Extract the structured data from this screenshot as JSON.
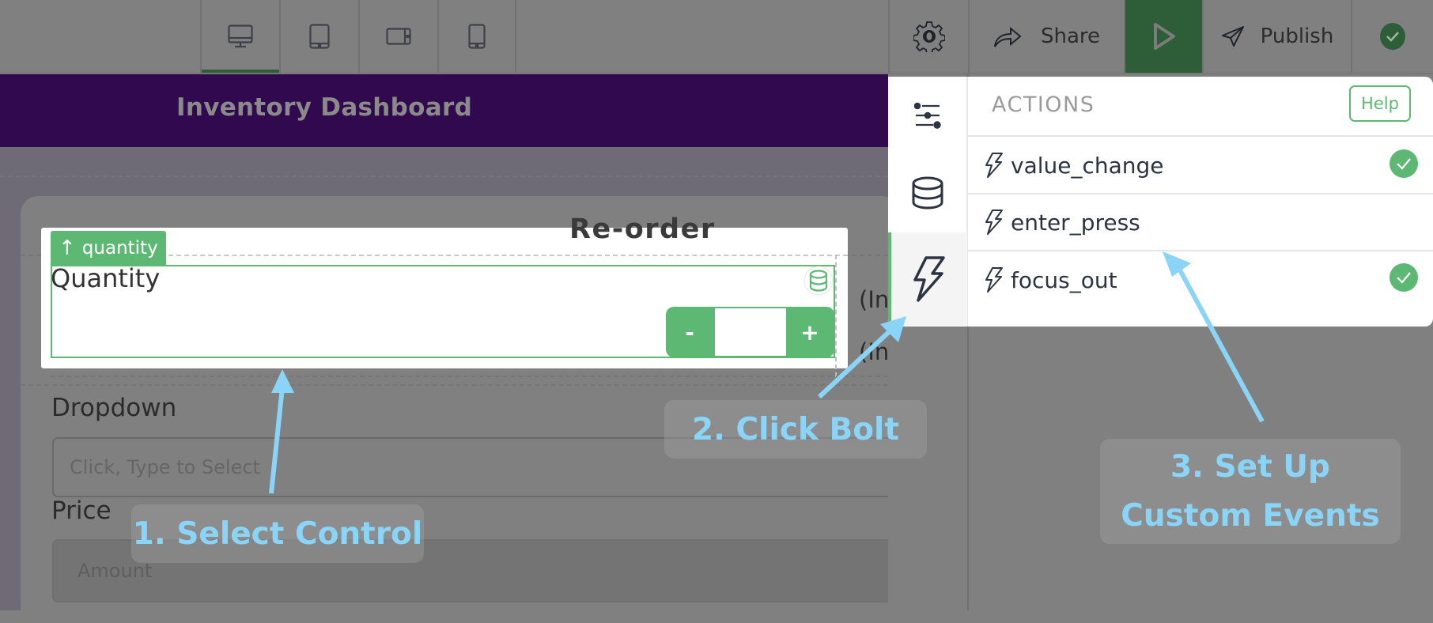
{
  "topbar": {
    "device_tabs": [
      {
        "name": "desktop",
        "icon": "desktop-icon",
        "active": true
      },
      {
        "name": "tablet-portrait",
        "icon": "tablet-icon",
        "active": false
      },
      {
        "name": "tablet-landscape",
        "icon": "tablet-landscape-icon",
        "active": false
      },
      {
        "name": "mobile",
        "icon": "mobile-icon",
        "active": false
      }
    ],
    "settings_icon": "gear-icon",
    "share_label": "Share",
    "preview_icon": "play-icon",
    "publish_label": "Publish",
    "status_icon": "check-circle-icon"
  },
  "app": {
    "title": "Inventory Dashboard"
  },
  "form": {
    "section_title": "Re-order",
    "selected_tag": "quantity",
    "quantity_label": "Quantity",
    "stepper_minus": "-",
    "stepper_plus": "+",
    "stepper_value": "",
    "side_text_1": "(In",
    "side_text_2": "(In",
    "dropdown_label": "Dropdown",
    "dropdown_placeholder": "Click, Type to Select",
    "price_label": "Price",
    "price_placeholder": "Amount"
  },
  "panel": {
    "tabs": [
      {
        "name": "properties",
        "icon": "sliders-icon",
        "active": false
      },
      {
        "name": "data",
        "icon": "database-icon",
        "active": false
      },
      {
        "name": "actions",
        "icon": "bolt-icon",
        "active": true
      }
    ],
    "heading": "ACTIONS",
    "help_label": "Help",
    "actions": [
      {
        "name": "value_change",
        "configured": true
      },
      {
        "name": "enter_press",
        "configured": false
      },
      {
        "name": "focus_out",
        "configured": true
      }
    ]
  },
  "callouts": {
    "step1": "1. Select Control",
    "step2": "2. Click Bolt",
    "step3_line1": "3. Set Up",
    "step3_line2": "Custom Events"
  },
  "colors": {
    "accent_green": "#5db873",
    "header_purple": "#30094f",
    "callout_blue": "#8ad4f7"
  }
}
